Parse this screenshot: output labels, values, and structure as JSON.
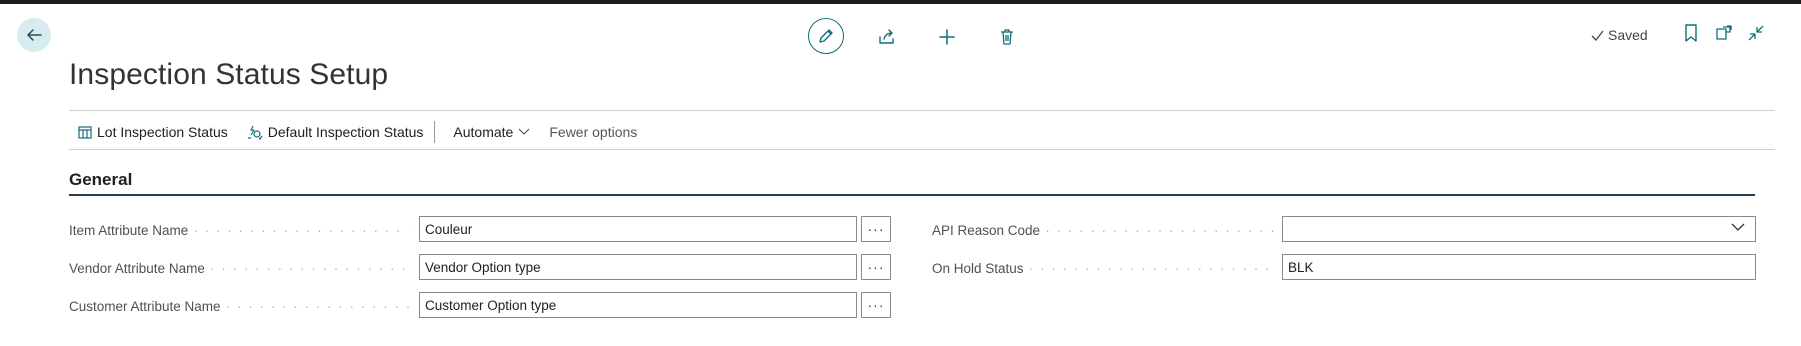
{
  "page": {
    "title": "Inspection Status Setup"
  },
  "status": {
    "saved_label": "Saved"
  },
  "actions": {
    "lot_inspection_status": "Lot Inspection Status",
    "default_inspection_status": "Default Inspection Status",
    "automate": "Automate",
    "fewer_options": "Fewer options"
  },
  "section": {
    "general": "General"
  },
  "fields": {
    "item_attribute_name": {
      "label": "Item Attribute Name",
      "value": "Couleur"
    },
    "vendor_attribute_name": {
      "label": "Vendor Attribute Name",
      "value": "Vendor Option type"
    },
    "customer_attribute_name": {
      "label": "Customer Attribute Name",
      "value": "Customer Option type"
    },
    "api_reason_code": {
      "label": "API Reason Code",
      "value": ""
    },
    "on_hold_status": {
      "label": "On Hold Status",
      "value": "BLK"
    }
  },
  "colors": {
    "accent": "#0e6f7a",
    "back_button_bg": "#d6ecef",
    "section_line": "#2a3e52"
  }
}
